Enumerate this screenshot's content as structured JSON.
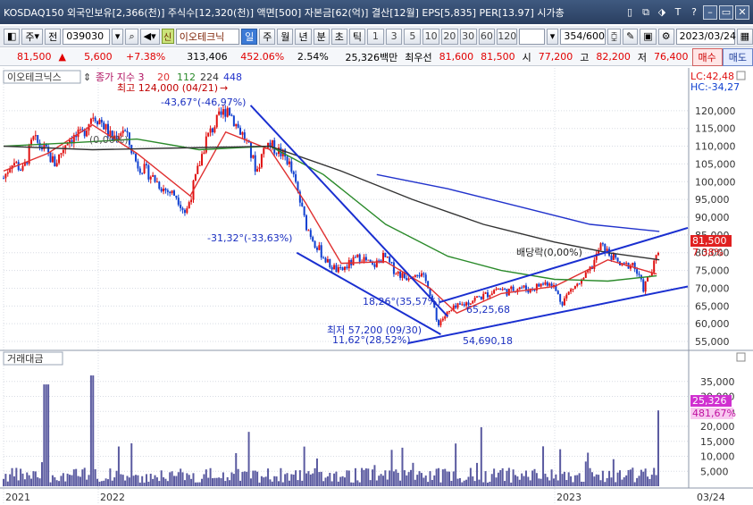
{
  "titlebar": {
    "text": "KOSDAQ150 외국인보유[2,366(천)] 주식수[12,320(천)] 액면[500] 자본금[62(억)] 결산[12월] EPS[5,835] PER[13.97] 시가총",
    "buttons": [
      "▯",
      "⧉",
      "⬗",
      "T",
      "?",
      "–",
      "▭",
      "✕"
    ]
  },
  "toolbar": {
    "mode_label": "주",
    "prev_label": "전",
    "code": "039030",
    "sin_badge": "신",
    "stock_name": "이오테크닉",
    "periods": [
      "일",
      "주",
      "월",
      "년",
      "분",
      "초",
      "틱"
    ],
    "selected_period": "일",
    "counts": [
      "1",
      "3",
      "5",
      "10",
      "20",
      "30",
      "60",
      "120"
    ],
    "bars_current": "354",
    "bars_total": "/600",
    "date": "2023/03/24"
  },
  "quote": {
    "price": "81,500",
    "change": "5,600",
    "change_pct": "+7.38%",
    "volume": "313,406",
    "volume_ratio": "452.06%",
    "turnover": "2.54%",
    "amount": "25,326백만",
    "priority_label": "최우선",
    "ask": "81,600",
    "bid": "81,500",
    "open_label": "시",
    "open": "77,200",
    "high_label": "고",
    "high": "82,200",
    "low_label": "저",
    "low": "76,400",
    "buy_label": "매수",
    "sell_label": "매도"
  },
  "price_pane": {
    "stock_label": "이오테크닉스",
    "ma_label": "종가 지수 3",
    "ma_values": [
      "20",
      "112",
      "224",
      "448"
    ],
    "lc": "LC:42,48",
    "hc": "HC:-34,27",
    "current_price_tag": "81,500",
    "current_pct_tag": "7.38%",
    "high_note": "최고 124,000 (04/21)",
    "low_note": "최저 57,200 (09/30)",
    "annotations": {
      "a1": "-43,67°(-46,97%)",
      "a2": "(0,00%)",
      "a3": "-31,32°(-33,63%)",
      "a4": "18,26°(35,57%)",
      "a5": "65,25,68",
      "a6": "11,62°(28,52%)",
      "a7": "54,690,18",
      "a8": "배당락(0,00%)"
    }
  },
  "volume_pane": {
    "label": "거래대금",
    "current_tag": "25,326",
    "pct_tag": "481,67%"
  },
  "chart_data": {
    "type": "candlestick",
    "price_axis_ticks": [
      55000,
      60000,
      65000,
      70000,
      75000,
      80000,
      85000,
      90000,
      95000,
      100000,
      105000,
      110000,
      115000,
      120000
    ],
    "price_axis_labels": [
      "55,000",
      "60,000",
      "65,000",
      "70,000",
      "75,000",
      "80,000",
      "85,000",
      "90,000",
      "95,000",
      "100,000",
      "105,000",
      "110,000",
      "115,000",
      "120,000"
    ],
    "ylim": [
      53500,
      126000
    ],
    "volume_axis_ticks": [
      5000,
      10000,
      15000,
      20000,
      25000,
      30000,
      35000
    ],
    "volume_axis_labels": [
      "5,000",
      "10,000",
      "15,000",
      "20,000",
      "25,000",
      "30,000",
      "35,000"
    ],
    "volume_ylim": [
      0,
      40000
    ],
    "x_labels": [
      "2021",
      "2022",
      "2023",
      "03/24"
    ],
    "close_series": [
      {
        "t": 0,
        "v": 101000
      },
      {
        "t": 10,
        "v": 106000
      },
      {
        "t": 22,
        "v": 103000
      },
      {
        "t": 33,
        "v": 112000
      },
      {
        "t": 46,
        "v": 109000
      },
      {
        "t": 58,
        "v": 105000
      },
      {
        "t": 72,
        "v": 112000
      },
      {
        "t": 88,
        "v": 113000
      },
      {
        "t": 100,
        "v": 119000
      },
      {
        "t": 110,
        "v": 117000
      },
      {
        "t": 122,
        "v": 112000
      },
      {
        "t": 135,
        "v": 115000
      },
      {
        "t": 150,
        "v": 105000
      },
      {
        "t": 165,
        "v": 102000
      },
      {
        "t": 180,
        "v": 98000
      },
      {
        "t": 195,
        "v": 96000
      },
      {
        "t": 205,
        "v": 91000
      },
      {
        "t": 215,
        "v": 100000
      },
      {
        "t": 228,
        "v": 112000
      },
      {
        "t": 240,
        "v": 117000
      },
      {
        "t": 252,
        "v": 121000
      },
      {
        "t": 262,
        "v": 116000
      },
      {
        "t": 272,
        "v": 112000
      },
      {
        "t": 285,
        "v": 103000
      },
      {
        "t": 295,
        "v": 111000
      },
      {
        "t": 308,
        "v": 109000
      },
      {
        "t": 320,
        "v": 106000
      },
      {
        "t": 330,
        "v": 98000
      },
      {
        "t": 340,
        "v": 88000
      },
      {
        "t": 352,
        "v": 82000
      },
      {
        "t": 365,
        "v": 77000
      },
      {
        "t": 378,
        "v": 74500
      },
      {
        "t": 390,
        "v": 77000
      },
      {
        "t": 402,
        "v": 79000
      },
      {
        "t": 415,
        "v": 76000
      },
      {
        "t": 428,
        "v": 79000
      },
      {
        "t": 440,
        "v": 75000
      },
      {
        "t": 452,
        "v": 73000
      },
      {
        "t": 465,
        "v": 75000
      },
      {
        "t": 478,
        "v": 71000
      },
      {
        "t": 488,
        "v": 60000
      },
      {
        "t": 496,
        "v": 62000
      },
      {
        "t": 506,
        "v": 64000
      },
      {
        "t": 518,
        "v": 65500
      },
      {
        "t": 530,
        "v": 67000
      },
      {
        "t": 542,
        "v": 68000
      },
      {
        "t": 555,
        "v": 70000
      },
      {
        "t": 568,
        "v": 69000
      },
      {
        "t": 580,
        "v": 70500
      },
      {
        "t": 592,
        "v": 69500
      },
      {
        "t": 604,
        "v": 71000
      },
      {
        "t": 616,
        "v": 72000
      },
      {
        "t": 628,
        "v": 66000
      },
      {
        "t": 640,
        "v": 70000
      },
      {
        "t": 652,
        "v": 72000
      },
      {
        "t": 662,
        "v": 76000
      },
      {
        "t": 672,
        "v": 82000
      },
      {
        "t": 684,
        "v": 79000
      },
      {
        "t": 696,
        "v": 76000
      },
      {
        "t": 708,
        "v": 77000
      },
      {
        "t": 720,
        "v": 70000
      },
      {
        "t": 730,
        "v": 75000
      },
      {
        "t": 738,
        "v": 81500
      }
    ],
    "moving_averages": [
      {
        "name": "20",
        "color": "#e03030",
        "points": [
          {
            "t": 0,
            "v": 103000
          },
          {
            "t": 50,
            "v": 108000
          },
          {
            "t": 100,
            "v": 116000
          },
          {
            "t": 150,
            "v": 108000
          },
          {
            "t": 210,
            "v": 96000
          },
          {
            "t": 250,
            "v": 114000
          },
          {
            "t": 300,
            "v": 109000
          },
          {
            "t": 340,
            "v": 94000
          },
          {
            "t": 380,
            "v": 77000
          },
          {
            "t": 430,
            "v": 77500
          },
          {
            "t": 480,
            "v": 70000
          },
          {
            "t": 510,
            "v": 63000
          },
          {
            "t": 560,
            "v": 68500
          },
          {
            "t": 620,
            "v": 70500
          },
          {
            "t": 680,
            "v": 78000
          },
          {
            "t": 735,
            "v": 74000
          }
        ]
      },
      {
        "name": "112",
        "color": "#2a8a2a",
        "points": [
          {
            "t": 0,
            "v": 110000
          },
          {
            "t": 80,
            "v": 111000
          },
          {
            "t": 150,
            "v": 112000
          },
          {
            "t": 220,
            "v": 109000
          },
          {
            "t": 300,
            "v": 110000
          },
          {
            "t": 360,
            "v": 102000
          },
          {
            "t": 430,
            "v": 88000
          },
          {
            "t": 500,
            "v": 79000
          },
          {
            "t": 560,
            "v": 75000
          },
          {
            "t": 620,
            "v": 72500
          },
          {
            "t": 680,
            "v": 72000
          },
          {
            "t": 735,
            "v": 73500
          }
        ]
      },
      {
        "name": "224",
        "color": "#333333",
        "points": [
          {
            "t": 0,
            "v": 110000
          },
          {
            "t": 100,
            "v": 109000
          },
          {
            "t": 200,
            "v": 109500
          },
          {
            "t": 300,
            "v": 110000
          },
          {
            "t": 380,
            "v": 103000
          },
          {
            "t": 460,
            "v": 95000
          },
          {
            "t": 540,
            "v": 88000
          },
          {
            "t": 620,
            "v": 83000
          },
          {
            "t": 680,
            "v": 80000
          },
          {
            "t": 738,
            "v": 78000
          }
        ]
      },
      {
        "name": "448",
        "color": "#2233cc",
        "points": [
          {
            "t": 420,
            "v": 102000
          },
          {
            "t": 500,
            "v": 98000
          },
          {
            "t": 580,
            "v": 93000
          },
          {
            "t": 660,
            "v": 88000
          },
          {
            "t": 738,
            "v": 86000
          }
        ]
      }
    ],
    "trend_lines": [
      {
        "from": {
          "t": 278,
          "v": 121500
        },
        "to": {
          "t": 500,
          "v": 62000
        }
      },
      {
        "from": {
          "t": 330,
          "v": 80000
        },
        "to": {
          "t": 492,
          "v": 57000
        }
      },
      {
        "from": {
          "t": 490,
          "v": 66000
        },
        "to": {
          "t": 770,
          "v": 87000
        }
      },
      {
        "from": {
          "t": 455,
          "v": 54500
        },
        "to": {
          "t": 770,
          "v": 70500
        }
      }
    ],
    "total_t": 770
  },
  "colors": {
    "up": "#e01010",
    "down": "#1040d0",
    "volume_bar": "#5a5aa0",
    "grid": "#d8dce4",
    "price_tag_bg": "#e02020",
    "volume_tag_bg": "#d030d0"
  }
}
